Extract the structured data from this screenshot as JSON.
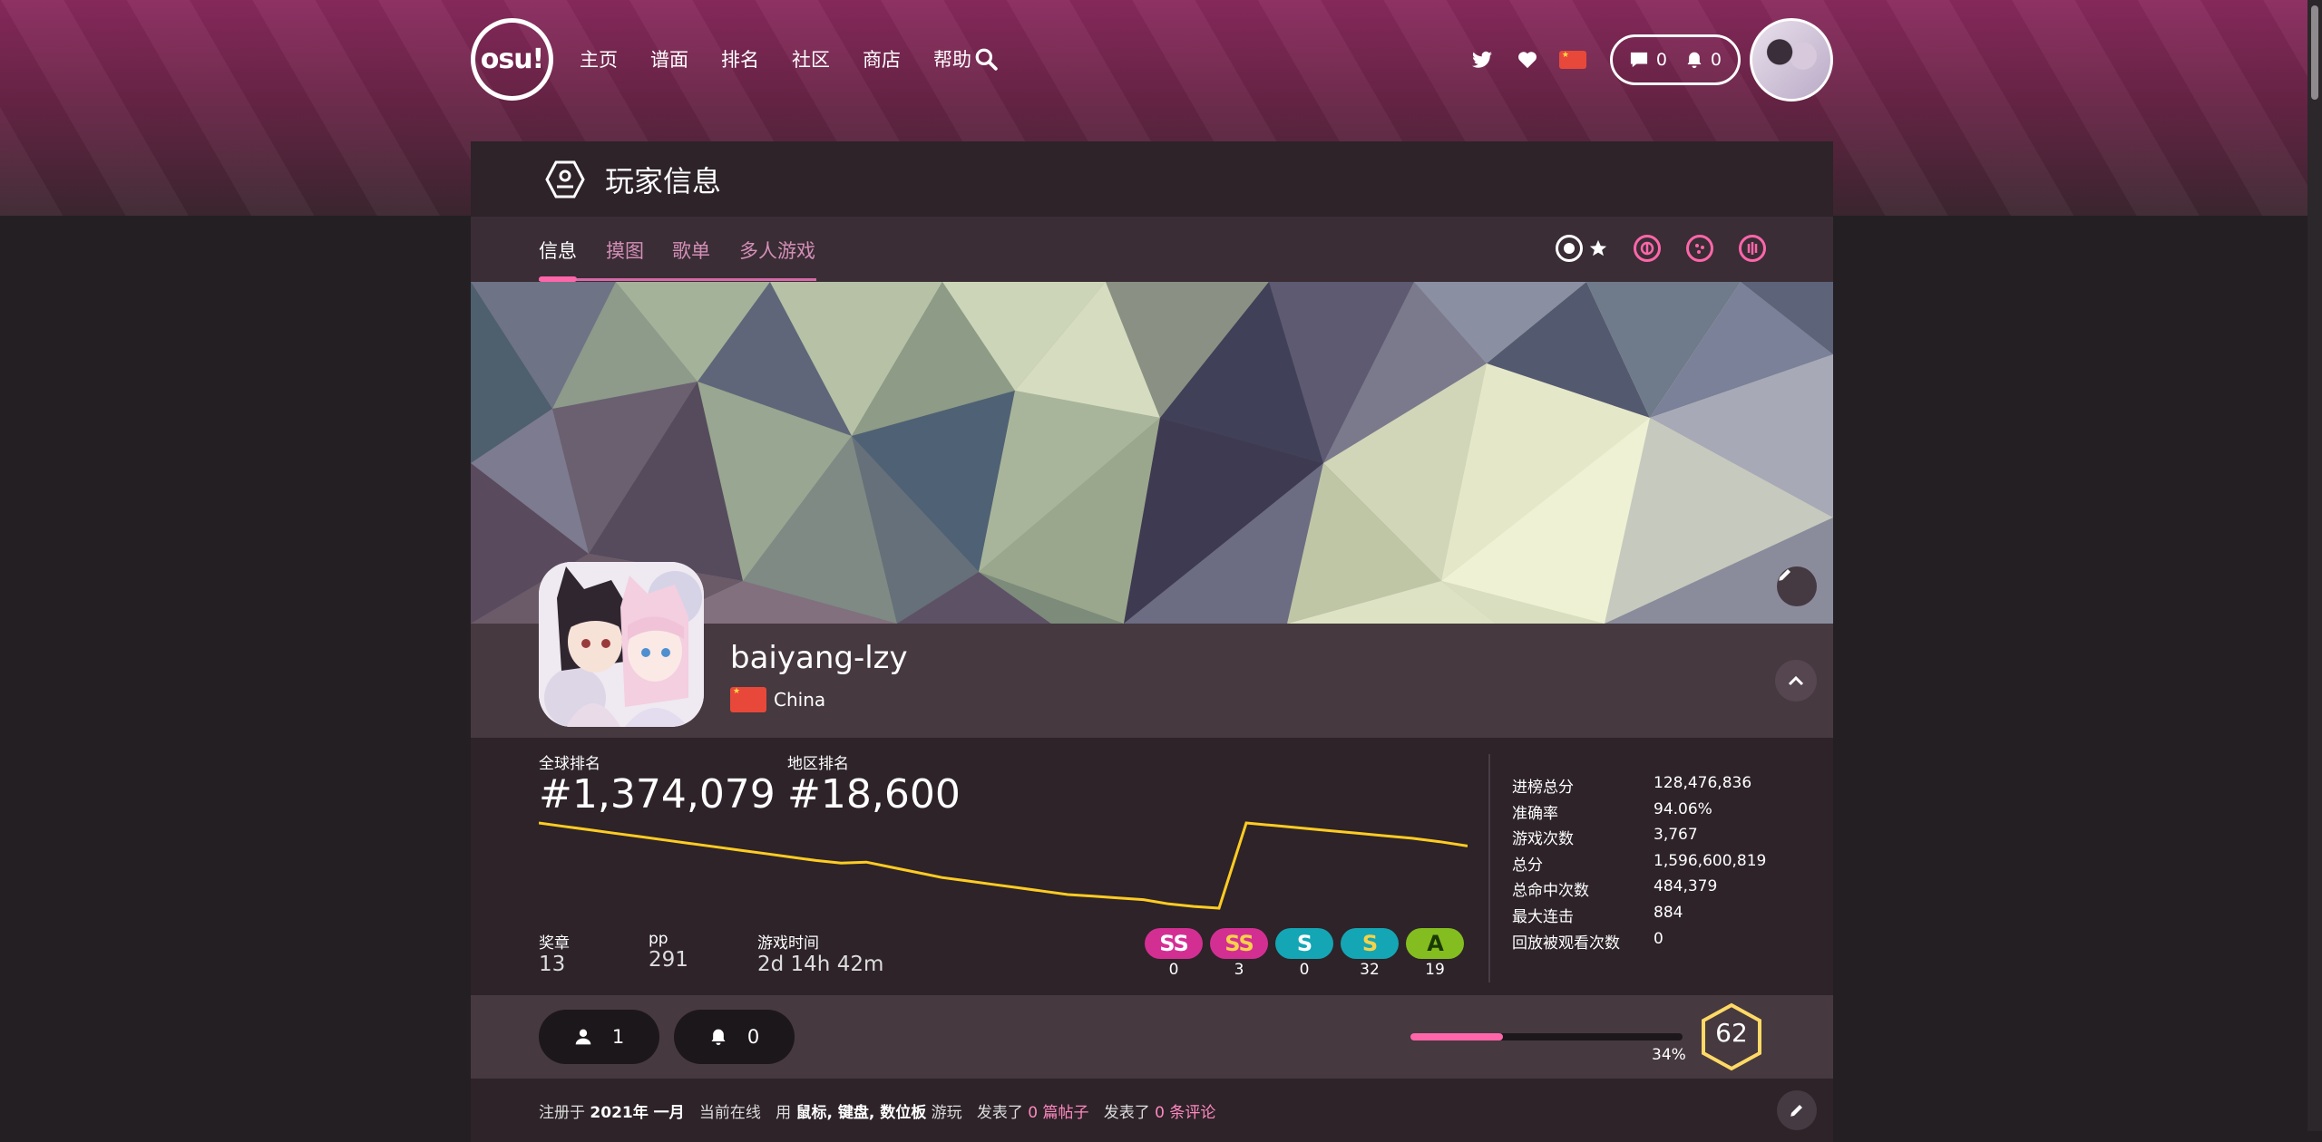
{
  "nav": {
    "logo": "osu!",
    "menu": [
      "主页",
      "谱面",
      "排名",
      "社区",
      "商店",
      "帮助"
    ],
    "chat_count": "0",
    "notification_count": "0"
  },
  "header": {
    "title": "玩家信息"
  },
  "tabs": [
    "信息",
    "摸图",
    "歌单",
    "多人游戏"
  ],
  "modes": [
    "osu",
    "taiko",
    "catch",
    "mania"
  ],
  "profile": {
    "username": "baiyang-lzy",
    "country": "China"
  },
  "ranks": {
    "global_label": "全球排名",
    "global_value": "#1,374,079",
    "country_label": "地区排名",
    "country_value": "#18,600"
  },
  "rank_history": {
    "series": [
      0.0,
      0.04,
      0.08,
      0.12,
      0.16,
      0.2,
      0.24,
      0.28,
      0.32,
      0.36,
      0.4,
      0.44,
      0.47,
      0.46,
      0.52,
      0.58,
      0.64,
      0.68,
      0.72,
      0.76,
      0.8,
      0.84,
      0.86,
      0.88,
      0.9,
      0.95,
      0.98,
      1.0,
      0.0,
      0.03,
      0.06,
      0.09,
      0.12,
      0.15,
      0.18,
      0.22,
      0.27
    ]
  },
  "mini_stats": [
    {
      "label": "奖章",
      "value": "13"
    },
    {
      "label": "pp",
      "value": "291"
    },
    {
      "label": "游戏时间",
      "value": "2d 14h 42m"
    }
  ],
  "grades": [
    {
      "label": "SS",
      "count": "0",
      "color": "#d32f93",
      "text": "#ffffff"
    },
    {
      "label": "SS",
      "count": "3",
      "color": "#d32f93",
      "text": "#f5d24a"
    },
    {
      "label": "S",
      "count": "0",
      "color": "#14a6b4",
      "text": "#ffffff"
    },
    {
      "label": "S",
      "count": "32",
      "color": "#14a6b4",
      "text": "#f5d24a"
    },
    {
      "label": "A",
      "count": "19",
      "color": "#84bd20",
      "text": "#1b3a00"
    }
  ],
  "right_stats": [
    {
      "label": "进榜总分",
      "value": "128,476,836"
    },
    {
      "label": "准确率",
      "value": "94.06%"
    },
    {
      "label": "游戏次数",
      "value": "3,767"
    },
    {
      "label": "总分",
      "value": "1,596,600,819"
    },
    {
      "label": "总命中次数",
      "value": "484,379"
    },
    {
      "label": "最大连击",
      "value": "884"
    },
    {
      "label": "回放被观看次数",
      "value": "0"
    }
  ],
  "social": {
    "followers": "1",
    "subscribers": "0"
  },
  "level": {
    "progress_fraction": 0.34,
    "progress_text": "34%",
    "level": "62"
  },
  "info": {
    "joined_prefix": "注册于 ",
    "joined_date": "2021年 一月",
    "online": "当前在线",
    "uses_prefix": "用 ",
    "devices": "鼠标, 键盘, 数位板",
    "uses_suffix": " 游玩",
    "posts_prefix": "发表了 ",
    "posts": "0 篇帖子",
    "comments_prefix": "发表了 ",
    "comments": "0 条评论"
  },
  "colors": {
    "accent": "#ff66aa",
    "chart_line": "#ffcc22",
    "level_hex": "#ffd966"
  }
}
